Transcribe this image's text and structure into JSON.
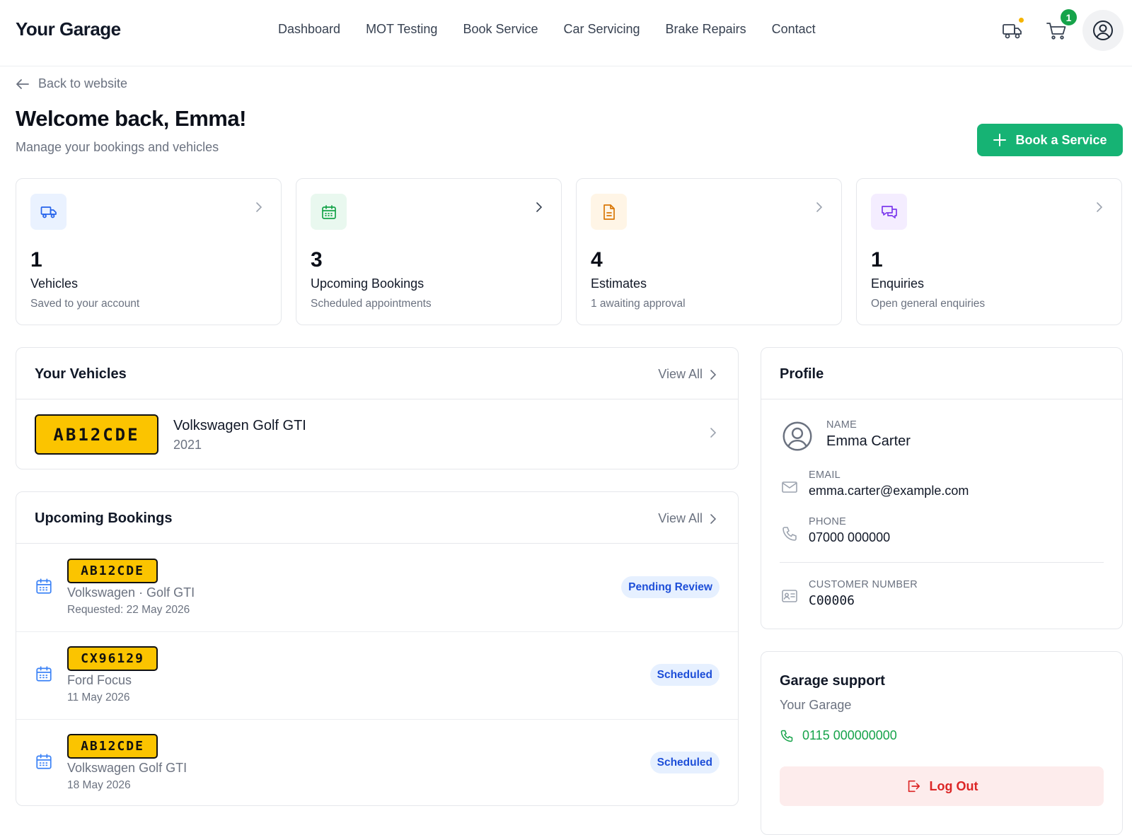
{
  "header": {
    "brand": "Your Garage",
    "nav": [
      "Dashboard",
      "MOT Testing",
      "Book Service",
      "Car Servicing",
      "Brake Repairs",
      "Contact"
    ],
    "cart_count": "1"
  },
  "intro": {
    "back_label": "Back to website",
    "welcome": "Welcome back, Emma!",
    "subtitle": "Manage your bookings and vehicles",
    "book_button": "Book a Service"
  },
  "stats": [
    {
      "value": "1",
      "label": "Vehicles",
      "sub": "Saved to your account",
      "icon": "truck-icon",
      "color": "#2563eb",
      "bg": "#eaf2ff"
    },
    {
      "value": "3",
      "label": "Upcoming Bookings",
      "sub": "Scheduled appointments",
      "icon": "calendar-icon",
      "color": "#16a34a",
      "bg": "#e9f8ef"
    },
    {
      "value": "4",
      "label": "Estimates",
      "sub": "1 awaiting approval",
      "icon": "document-icon",
      "color": "#d97706",
      "bg": "#fff5e6"
    },
    {
      "value": "1",
      "label": "Enquiries",
      "sub": "Open general enquiries",
      "icon": "chat-icon",
      "color": "#7c3aed",
      "bg": "#f4edff"
    }
  ],
  "vehicles": {
    "title": "Your Vehicles",
    "view_all": "View All",
    "items": [
      {
        "plate": "AB12CDE",
        "name": "Volkswagen Golf GTI",
        "year": "2021"
      }
    ]
  },
  "bookings": {
    "title": "Upcoming Bookings",
    "view_all": "View All",
    "items": [
      {
        "plate": "AB12CDE",
        "car": "Volkswagen · Golf GTI",
        "date": "Requested: 22 May 2026",
        "status": "Pending Review"
      },
      {
        "plate": "CX96129",
        "car": "Ford Focus",
        "date": "11 May 2026",
        "status": "Scheduled"
      },
      {
        "plate": "AB12CDE",
        "car": "Volkswagen Golf GTI",
        "date": "18 May 2026",
        "status": "Scheduled"
      }
    ]
  },
  "profile": {
    "title": "Profile",
    "name_label": "NAME",
    "name": "Emma Carter",
    "email_label": "EMAIL",
    "email": "emma.carter@example.com",
    "phone_label": "PHONE",
    "phone": "07000 000000",
    "customer_label": "CUSTOMER NUMBER",
    "customer_number": "C00006"
  },
  "support": {
    "title": "Garage support",
    "garage": "Your Garage",
    "phone": "0115 000000000",
    "logout": "Log Out"
  },
  "colors": {
    "accent_green": "#16b374",
    "plate_yellow": "#fbc400",
    "status_blue": "#1d4ed8",
    "logout_red": "#dc2626"
  }
}
